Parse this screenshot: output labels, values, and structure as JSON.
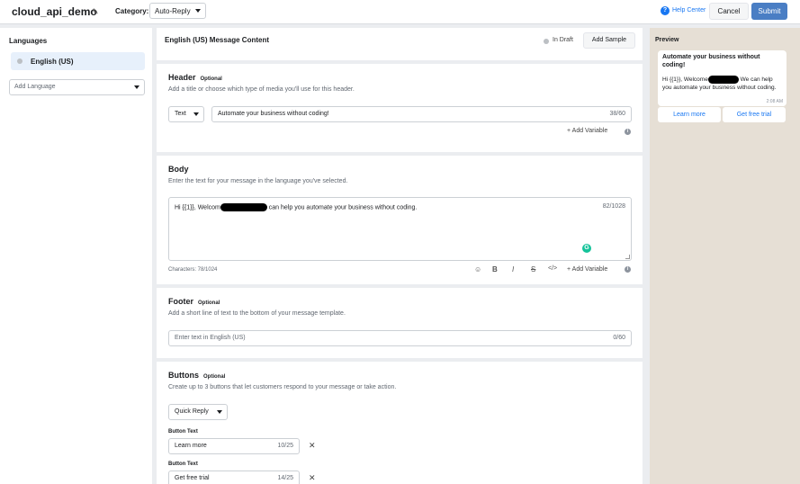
{
  "topbar": {
    "app_title": "cloud_api_demo",
    "category_label": "Category:",
    "category_value": "Auto-Reply",
    "help_center": "Help Center",
    "cancel": "Cancel",
    "submit": "Submit"
  },
  "sidebar": {
    "title": "Languages",
    "language": "English (US)",
    "add_language": "Add Language"
  },
  "content": {
    "title": "English (US) Message Content",
    "status": "In Draft",
    "add_sample": "Add Sample"
  },
  "header": {
    "title": "Header",
    "optional": "Optional",
    "description": "Add a title or choose which type of media you'll use for this header.",
    "type": "Text",
    "value": "Automate your business without coding!",
    "counter": "38/60",
    "add_variable": "+ Add Variable"
  },
  "body": {
    "title": "Body",
    "description": "Enter the text for your message in the language you've selected.",
    "text_before": "Hi {{1}}, Welcom",
    "text_after": " can help you automate your business without coding.",
    "counter": "82/1028",
    "characters": "Characters: 78/1024",
    "add_variable": "+ Add Variable"
  },
  "footer": {
    "title": "Footer",
    "optional": "Optional",
    "description": "Add a short line of text to the bottom of your message template.",
    "placeholder": "Enter text in English (US)",
    "counter": "0/60"
  },
  "buttons": {
    "title": "Buttons",
    "optional": "Optional",
    "description": "Create up to 3 buttons that let customers respond to your message or take action.",
    "type": "Quick Reply",
    "items": [
      {
        "label": "Button Text",
        "value": "Learn more",
        "counter": "10/25"
      },
      {
        "label": "Button Text",
        "value": "Get free trial",
        "counter": "14/25"
      }
    ]
  },
  "preview": {
    "title": "Preview",
    "bubble_title": "Automate your business without coding!",
    "bubble_before": "Hi {{1}}, Welcome",
    "bubble_after": " We can help you automate your business without coding.",
    "time": "2:08 AM",
    "buttons": [
      "Learn more",
      "Get free trial"
    ]
  },
  "colors": {
    "accent": "#1877f2",
    "submit": "#4a7ec4",
    "selected_language": "#e7f0fb",
    "preview_bg": "#e6dfd5",
    "grammarly": "#15c39a"
  },
  "icons": {
    "edit": "pencil-icon",
    "help": "help-icon",
    "status": "draft-dot-icon",
    "info": "info-icon",
    "remove": "close-icon"
  }
}
